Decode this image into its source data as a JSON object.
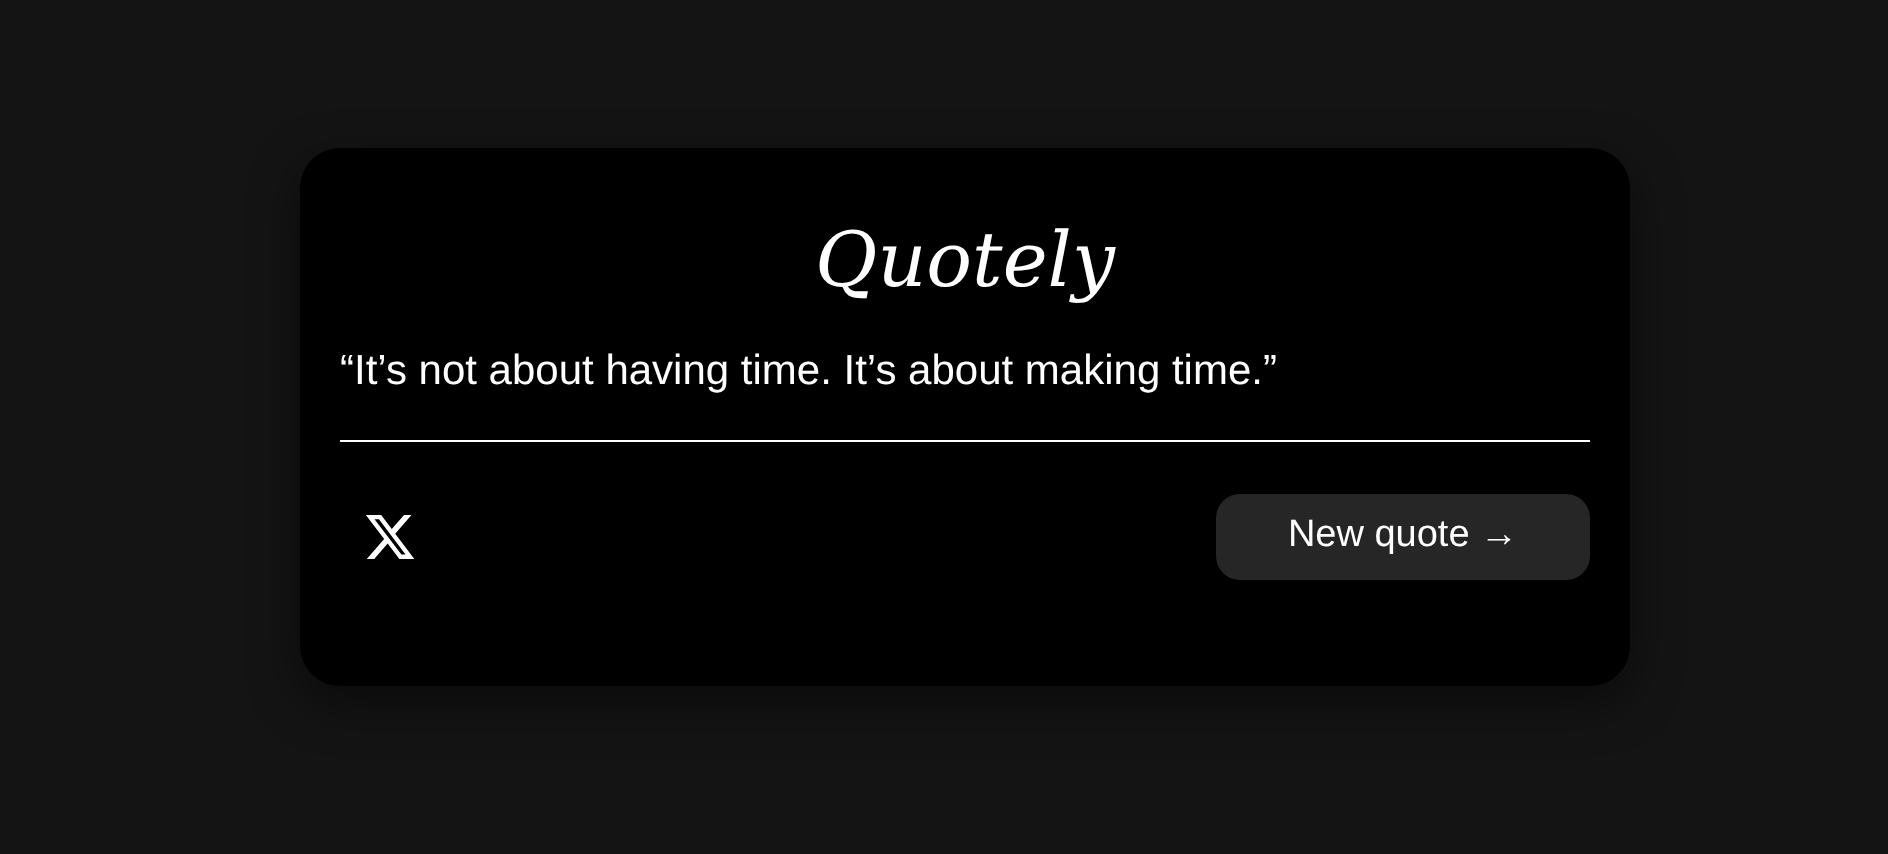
{
  "card": {
    "title": "Quotely",
    "quote": "“It’s not about having time. It’s about making time.”",
    "button": {
      "label": "New quote →"
    }
  }
}
